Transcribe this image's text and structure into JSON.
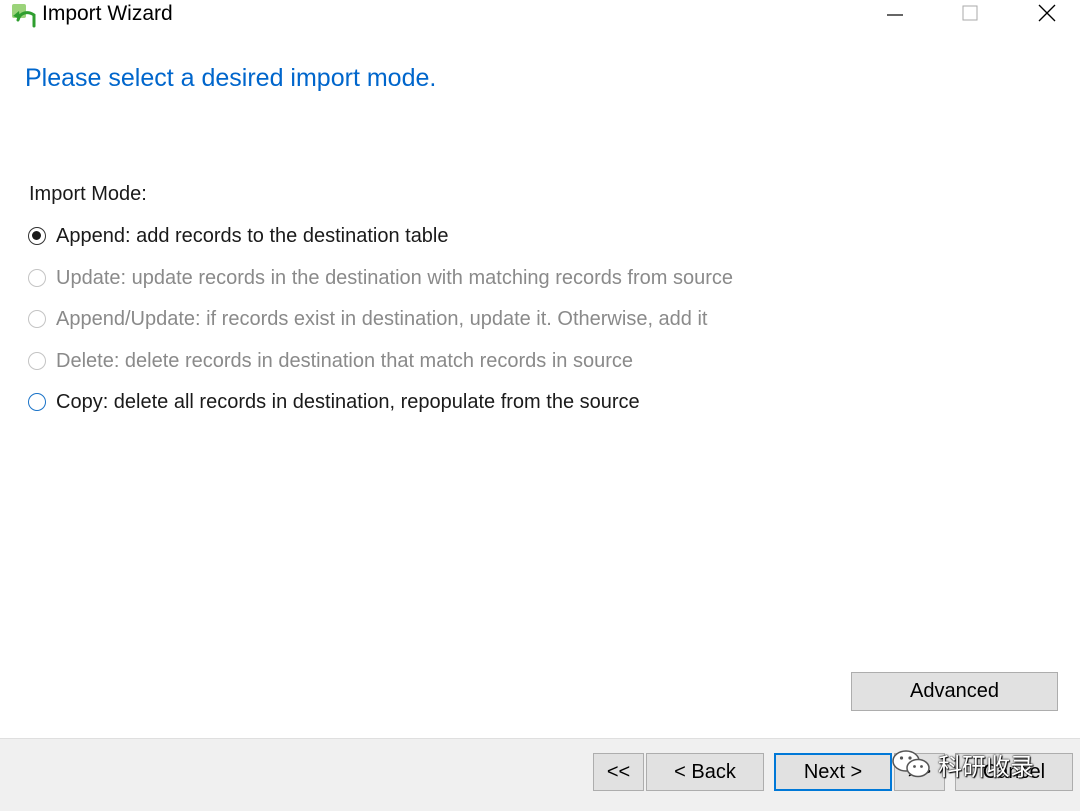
{
  "window": {
    "title": "Import Wizard",
    "icons": {
      "app": "import-arrow-icon",
      "minimize": "minimize-icon",
      "maximize": "maximize-icon",
      "close": "close-icon"
    }
  },
  "heading": "Please select a desired import mode.",
  "mode_label": "Import Mode:",
  "options": [
    {
      "label": "Append: add records to the destination table",
      "checked": true,
      "disabled": false
    },
    {
      "label": "Update: update records in the destination with matching records from source",
      "checked": false,
      "disabled": true
    },
    {
      "label": "Append/Update: if records exist in destination, update it. Otherwise, add it",
      "checked": false,
      "disabled": true
    },
    {
      "label": "Delete: delete records in destination that match records in source",
      "checked": false,
      "disabled": true
    },
    {
      "label": "Copy: delete all records in destination, repopulate from the source",
      "checked": false,
      "disabled": false
    }
  ],
  "buttons": {
    "advanced": "Advanced",
    "first": "<<",
    "back": "< Back",
    "next": "Next >",
    "finish": ">>",
    "cancel": "Cancel"
  },
  "watermark": {
    "text": "科研收录",
    "icon": "wechat-icon"
  },
  "colors": {
    "heading": "#0066cc",
    "focus_border": "#0078d7",
    "disabled_text": "#8a8a8a"
  }
}
